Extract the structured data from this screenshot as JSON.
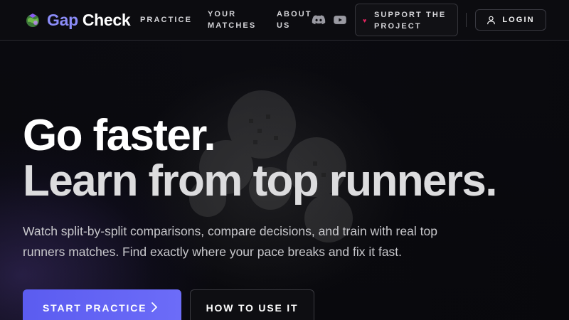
{
  "header": {
    "brand": {
      "part1": "Gap",
      "part2": "Check",
      "logo_icon": "globe-logo-icon"
    },
    "nav": {
      "practice": "PRACTICE",
      "your_matches": "YOUR MATCHES",
      "about_us": "ABOUT US"
    },
    "social": {
      "discord_icon": "discord-icon",
      "youtube_icon": "youtube-icon"
    },
    "support": {
      "label": "SUPPORT THE PROJECT",
      "icon": "heart-icon"
    },
    "login": {
      "label": "LOGIN",
      "icon": "user-icon"
    }
  },
  "hero": {
    "headline_line1": "Go faster.",
    "headline_line2": "Learn from top runners.",
    "subtitle": "Watch split-by-split comparisons, compare decisions, and train with real top runners matches. Find exactly where your pace breaks and fix it fast.",
    "primary_button": "START PRACTICE",
    "primary_button_icon": "chevron-right-icon",
    "secondary_button": "HOW TO USE IT"
  },
  "colors": {
    "accent": "#6366f1",
    "brand_gap": "#8b8cf8",
    "background": "#08080c",
    "heart": "#e0245e"
  }
}
